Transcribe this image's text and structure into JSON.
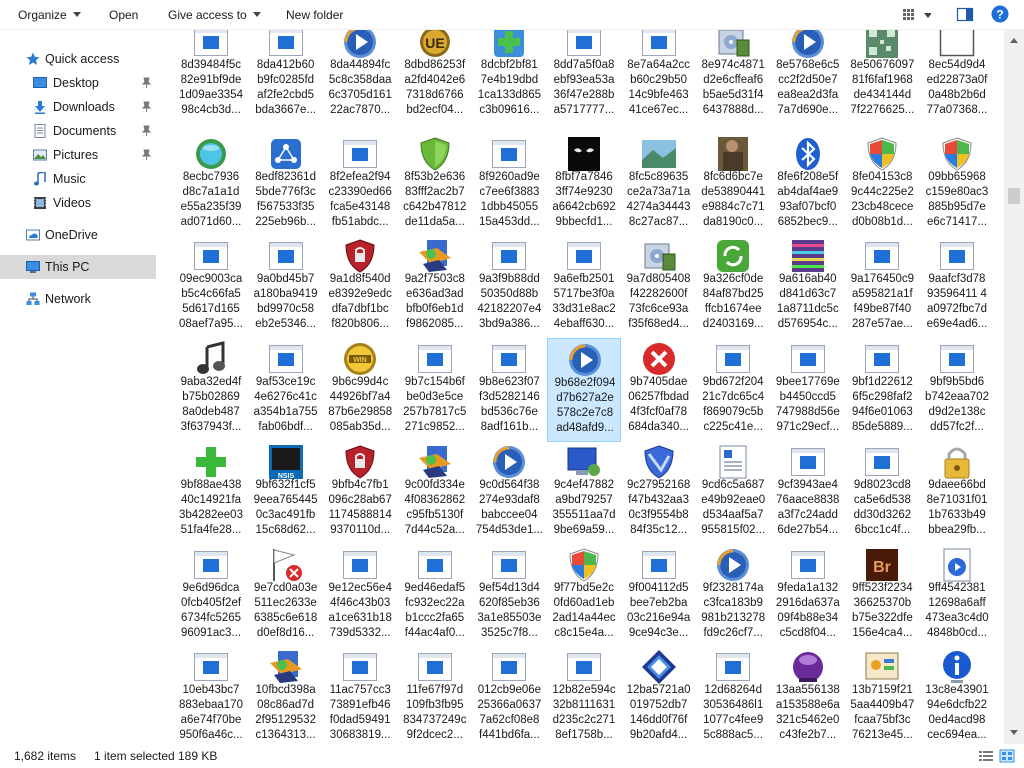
{
  "toolbar": {
    "organize": "Organize",
    "open": "Open",
    "give_access": "Give access to",
    "new_folder": "New folder"
  },
  "nav": {
    "items": [
      {
        "label": "Quick access",
        "icon": "star-icon"
      },
      {
        "label": "Desktop",
        "icon": "desktop-icon"
      },
      {
        "label": "Downloads",
        "icon": "download-icon"
      },
      {
        "label": "Documents",
        "icon": "documents-icon"
      },
      {
        "label": "Pictures",
        "icon": "pictures-icon"
      },
      {
        "label": "Music",
        "icon": "music-icon"
      },
      {
        "label": "Videos",
        "icon": "videos-icon"
      },
      {
        "label": "OneDrive",
        "icon": "cloud-icon"
      },
      {
        "label": "This PC",
        "icon": "computer-icon"
      },
      {
        "label": "Network",
        "icon": "network-icon"
      }
    ]
  },
  "files": [
    {
      "name": "8d39484f5c\n82e91bf9de\n1d09ae3354\n98c4cb3d...",
      "icon": "window"
    },
    {
      "name": "8da412b60\nb9fc0285fd\naf2fe2cbd5\nbda3667e...",
      "icon": "window"
    },
    {
      "name": "8da44894fc\n5c8c358daa\n6c3705d161\n22ac7870...",
      "icon": "media"
    },
    {
      "name": "8dbd86253f\na2fd4042e6\n7318d6766\nbd2ecf04...",
      "icon": "ue"
    },
    {
      "name": "8dcbf2bf81\n7e4b19dbd\n1ca133d865\nc3b09616...",
      "icon": "cross-green"
    },
    {
      "name": "8dd7a5f0a8\nebf93ea53a\n36f47e288b\na5717777...",
      "icon": "window"
    },
    {
      "name": "8e7a64a2cc\nb60c29b50\n14c9bfe463\n41ce67ec...",
      "icon": "window"
    },
    {
      "name": "8e974c4871\nd2e6cffeaf6\nb5ae5d31f4\n6437888d...",
      "icon": "setup"
    },
    {
      "name": "8e5768e6c5\ncc2f2d50e7\nea8ea2d3fa\n7a7d690e...",
      "icon": "media"
    },
    {
      "name": "8e50676097\n81f6faf1968\nde434144d\n7f2276625...",
      "icon": "qr"
    },
    {
      "name": "8ec54d9d4\ned22873a0f\n0a48b2b6d\n77a07368...",
      "icon": "blank"
    },
    {
      "name": "8ecbc7936\nd8c7a1a1d\ne55a235f39\nad071d60...",
      "icon": "globe-green"
    },
    {
      "name": "8edf82361d\n5bde776f3c\nf567533f35\n225eb96b...",
      "icon": "network-blue"
    },
    {
      "name": "8f2efea2f94\nc23390ed66\nfca5e43148\nfb51abdc...",
      "icon": "window"
    },
    {
      "name": "8f53b2e636\n83fff2ac2b7\nc642b47812\nde11da5a...",
      "icon": "shield-green"
    },
    {
      "name": "8f9260ad9e\nc7ee6f3883\n1dbb45055\n15a453dd...",
      "icon": "window"
    },
    {
      "name": "8fbf7a7846\n3ff74e9230\na6642cb692\n9bbecfd1...",
      "icon": "dark-eyes"
    },
    {
      "name": "8fc5c89635\nce2a73a71a\n4274a34443\n8c27ac87...",
      "icon": "landscape"
    },
    {
      "name": "8fc6d6bc7e\nde53890441\ne9884c7c71\nda8190c0...",
      "icon": "photo"
    },
    {
      "name": "8fe6f208e5f\nab4daf4ae9\n93af07bcf0\n6852bec9...",
      "icon": "bluetooth"
    },
    {
      "name": "8fe04153c8\n9c44c225e2\n23cb48cece\nd0b08b1d...",
      "icon": "shield-win"
    },
    {
      "name": "09bb65968\nc159e80ac3\n885b95d7e\ne6c71417...",
      "icon": "shield-win"
    },
    {
      "name": "09ec9003ca\nb5c4c66fa5\n5d617d165\n08aef7a95...",
      "icon": "window"
    },
    {
      "name": "9a0bd45b7\na180ba9419\nbd9970c58\neb2e5346...",
      "icon": "window"
    },
    {
      "name": "9a1d8f540d\ne8392e9edc\ndfa7dbf1bc\nf820b806...",
      "icon": "shield-red"
    },
    {
      "name": "9a2f7503c8\ne636ad3ad\nbfb0f6eb1d\nf9862085...",
      "icon": "installer"
    },
    {
      "name": "9a3f9b88dd\n50350d88b\n42182207e4\n3bd9a386...",
      "icon": "window"
    },
    {
      "name": "9a6efb2501\n5717be3f0a\n33d31e8ac2\n4ebaff630...",
      "icon": "window"
    },
    {
      "name": "9a7d805408\nf42282600f\n73fc6ce93a\nf35f68ed4...",
      "icon": "setup"
    },
    {
      "name": "9a326cf0de\n84af87bd25\nffcb1674ee\nd2403169...",
      "icon": "sync-green"
    },
    {
      "name": "9a616ab40\nd841d63c7\n1a8711dc5c\nd576954c...",
      "icon": "noise"
    },
    {
      "name": "9a176450c9\na595821a1f\nf49be87f40\n287e57ae...",
      "icon": "window"
    },
    {
      "name": "9aafcf3d78\n93596411 4\na0972fbc7d\ne69e4ad6...",
      "icon": "window"
    },
    {
      "name": "9aba32ed4f\nb75b02869\n8a0deb487\n3f637943f...",
      "icon": "music"
    },
    {
      "name": "9af53ce19c\n4e6276c41c\na354b1a755\nfab06bdf...",
      "icon": "window"
    },
    {
      "name": "9b6c99d4c\n44926bf7a4\n87b6e29858\n085ab35d...",
      "icon": "winrar"
    },
    {
      "name": "9b7c154b6f\nbe0d3e5ce\n257b7817c5\n271c9852...",
      "icon": "window"
    },
    {
      "name": "9b8e623f07\nf3d5282146\nbd536c76e\n8adf161b...",
      "icon": "window"
    },
    {
      "name": "9b68e2f094\nd7b627a2e\n578c2e7c8\nad48afd9...",
      "icon": "media",
      "selected": true
    },
    {
      "name": "9b7405dae\n06257fbdad\n4f3fcf0af78\n684da340...",
      "icon": "error"
    },
    {
      "name": "9bd672f204\n21c7dc65c4\nf869079c5b\nc225c41e...",
      "icon": "window"
    },
    {
      "name": "9bee17769e\nb4450ccd5\n747988d56e\n971c29ecf...",
      "icon": "window"
    },
    {
      "name": "9bf1d22612\n6f5c298faf2\n94f6e01063\n85de5889...",
      "icon": "window"
    },
    {
      "name": "9bf9b5bd6\nb742eaa702\nd9d2e138c\ndd57fc2f...",
      "icon": "window"
    },
    {
      "name": "9bf88ae438\n40c14921fa\n3b4282ee03\n51fa4fe28...",
      "icon": "plus-green"
    },
    {
      "name": "9bf632f1cf5\n9eea765445\n0c3ac491fb\n15c68d62...",
      "icon": "nsis"
    },
    {
      "name": "9bfb4c7fb1\n096c28ab67\n1174588814\n9370110d...",
      "icon": "shield-red"
    },
    {
      "name": "9c00fd334e\n4f08362862\nc95fb5130f\n7d44c52a...",
      "icon": "installer"
    },
    {
      "name": "9c0d564f38\n274e93daf8\nbabccee04\n754d53de1...",
      "icon": "media"
    },
    {
      "name": "9c4ef47882\na9bd79257\n355511aa7d\n9be69a59...",
      "icon": "monitor"
    },
    {
      "name": "9c27952168\nf47b432aa3\n0c3f9554b8\n84f35c12...",
      "icon": "shield-blue"
    },
    {
      "name": "9cd6c5a687\ne49b92eae0\nd534aaf5a7\n955815f02...",
      "icon": "document-blue"
    },
    {
      "name": "9cf3943ae4\n76aace8838\na3f7c24add\n6de27b54...",
      "icon": "window"
    },
    {
      "name": "9d8023cd8\nca5e6d538\ndd30d3262\n6bcc1c4f...",
      "icon": "window"
    },
    {
      "name": "9daee66bd\n8e71031f01\n1b7633b49\nbbea29fb...",
      "icon": "lock"
    },
    {
      "name": "9e6d96dca\n0fcb405f2ef\n6734fc5265\n96091ac3...",
      "icon": "window"
    },
    {
      "name": "9e7cd0a03e\n511ec2633e\n6385c6e618\nd0ef8d16...",
      "icon": "flag-error"
    },
    {
      "name": "9e12ec56e4\n4f46c43b03\na1ce631b18\n739d5332...",
      "icon": "window"
    },
    {
      "name": "9ed46edaf5\nfc932ec22a\nb1ccc2fa65\nf44ac4af0...",
      "icon": "window"
    },
    {
      "name": "9ef54d13d4\n620f85eb36\n3a1e85503e\n3525c7f8...",
      "icon": "window"
    },
    {
      "name": "9f77bd5e2c\n0fd60ad1eb\n2ad14a44ec\nc8c15e4a...",
      "icon": "shield-win"
    },
    {
      "name": "9f004112d5\nbee7eb2ba\n03c216e94a\n9ce94c3e...",
      "icon": "window"
    },
    {
      "name": "9f2328174a\nc3fca183b9\n981b213278\nfd9c26cf7...",
      "icon": "media"
    },
    {
      "name": "9feda1a132\n2916da637a\n09f4b88e34\nc5cd8f04...",
      "icon": "window"
    },
    {
      "name": "9ff523f2234\n36625370b\nb75e322dfe\n156e4ca4...",
      "icon": "bridge"
    },
    {
      "name": "9ff4542381\n12698a6aff\n473ea3c4d0\n4848b0cd...",
      "icon": "document-media"
    },
    {
      "name": "10eb43bc7\n883ebaa170\na6e74f70be\n950f6a46c...",
      "icon": "window"
    },
    {
      "name": "10fbcd398a\n08c86ad7d\n2f95129532\nc1364313...",
      "icon": "installer"
    },
    {
      "name": "11ac757cc3\n73891efb46\nf0dad59491\n30683819...",
      "icon": "window"
    },
    {
      "name": "11fe67f97d\n109fb3fb95\n834737249c\n9f2dcec2...",
      "icon": "window"
    },
    {
      "name": "012cb9e06e\n25366a0637\n7a62cf08e8\nf441bd6fa...",
      "icon": "window"
    },
    {
      "name": "12b82e594c\n32b8111631\nd235c2c271\n8ef1758b...",
      "icon": "window"
    },
    {
      "name": "12ba5721a0\n019752db7\n146dd0f76f\n9b20afd4...",
      "icon": "diamond-blue"
    },
    {
      "name": "12d68264d\n30536486l1\n1077c4fee9\n5c888ac5...",
      "icon": "window"
    },
    {
      "name": "13aa556138\na153588e6a\n321c5462e0\nc43fe2b7...",
      "icon": "orb-purple"
    },
    {
      "name": "13b7159f21\n5aa4409b47\nfcaa75bf3c\n76213e45...",
      "icon": "control-panel"
    },
    {
      "name": "13c8e43901\n94e6dcfb22\n0ed4acd98\ncec694ea...",
      "icon": "info"
    }
  ],
  "status": {
    "count": "1,682 items",
    "selection": "1 item selected",
    "size": "189 KB"
  }
}
